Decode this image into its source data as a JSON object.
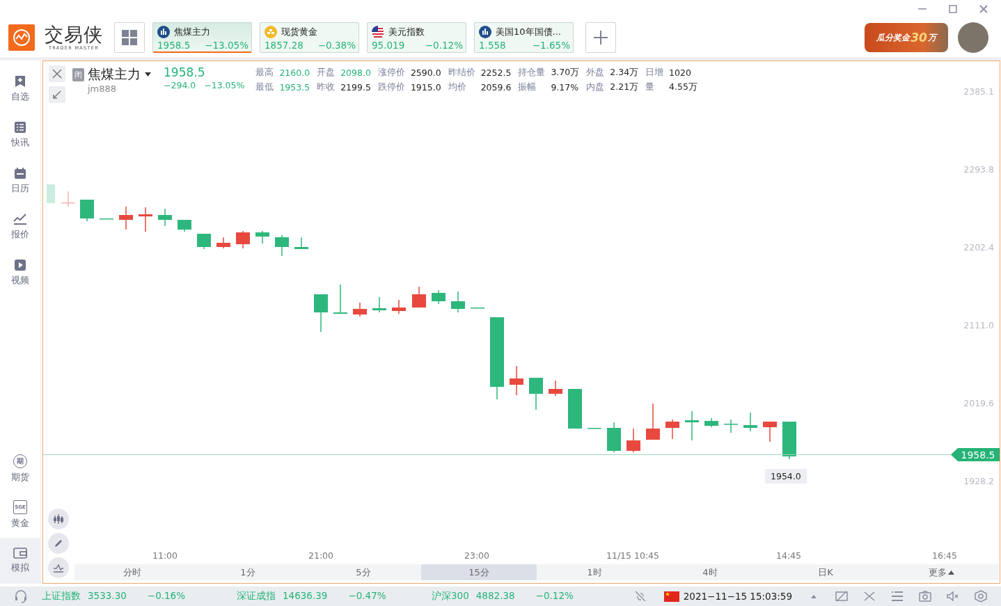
{
  "header": {
    "logo_text": "交易侠",
    "logo_subtitle": "TRADER MASTER",
    "quote_tabs": [
      {
        "kind": "chart",
        "name": "焦煤主力",
        "price": "1958.5",
        "change": "−13.05%",
        "selected": true
      },
      {
        "kind": "gold",
        "name": "现货黄金",
        "price": "1857.28",
        "change": "−0.38%",
        "selected": false
      },
      {
        "kind": "flag",
        "name": "美元指数",
        "price": "95.019",
        "change": "−0.12%",
        "selected": false
      },
      {
        "kind": "chart",
        "name": "美国10年国债...",
        "price": "1.558",
        "change": "−1.65%",
        "selected": false
      }
    ],
    "promo": {
      "text": "瓜分奖金",
      "amount": "30",
      "unit": "万"
    }
  },
  "sidebar": {
    "top": [
      {
        "kind": "bookmark",
        "label": "自选",
        "selected": false
      },
      {
        "kind": "list",
        "label": "快讯",
        "selected": false
      },
      {
        "kind": "calendar",
        "label": "日历",
        "selected": false
      },
      {
        "kind": "trend",
        "label": "报价",
        "selected": false
      },
      {
        "kind": "video",
        "label": "视频",
        "selected": false
      }
    ],
    "bottom": [
      {
        "kind": "futures",
        "badge": "期",
        "label": "期货",
        "selected": false
      },
      {
        "kind": "sge",
        "badge": "SGE",
        "label": "黄金",
        "selected": false
      },
      {
        "kind": "wallet",
        "label": "模拟",
        "selected": true
      }
    ]
  },
  "quote": {
    "status": "闭",
    "name": "焦煤主力",
    "code": "jm888",
    "price": "1958.5",
    "change": "−294.0",
    "change_pct": "−13.05%",
    "stats": [
      [
        {
          "label": "最高",
          "value": "2160.0",
          "color": "#25b377"
        },
        {
          "label": "开盘",
          "value": "2098.0",
          "color": "#25b377"
        },
        {
          "label": "涨停价",
          "value": "2590.0",
          "color": "#222222"
        },
        {
          "label": "昨结价",
          "value": "2252.5",
          "color": "#222222"
        },
        {
          "label": "持仓量",
          "value": "3.70万",
          "color": "#222222"
        },
        {
          "label": "外盘",
          "value": "2.34万",
          "color": "#222222"
        },
        {
          "label": "日增",
          "value": "1020",
          "color": "#222222"
        }
      ],
      [
        {
          "label": "最低",
          "value": "1953.5",
          "color": "#25b377"
        },
        {
          "label": "昨收",
          "value": "2199.5",
          "color": "#222222"
        },
        {
          "label": "跌停价",
          "value": "1915.0",
          "color": "#222222"
        },
        {
          "label": "均价",
          "value": "2059.6",
          "color": "#222222"
        },
        {
          "label": "振幅",
          "value": "9.17%",
          "color": "#222222"
        },
        {
          "label": "内盘",
          "value": "2.21万",
          "color": "#222222"
        },
        {
          "label": "量",
          "value": "4.55万",
          "color": "#222222"
        }
      ]
    ]
  },
  "chart": {
    "y_labels": [
      "2385.1",
      "2293.8",
      "2202.4",
      "2111.0",
      "2019.6",
      "1928.2"
    ],
    "x_labels": [
      "11:00",
      "21:00",
      "23:00",
      "11/15 10:45",
      "14:45",
      "16:45"
    ],
    "last_price": "1958.5",
    "low_marker": "1954.0"
  },
  "periods": [
    {
      "label": "分时",
      "selected": false
    },
    {
      "label": "1分",
      "selected": false
    },
    {
      "label": "5分",
      "selected": false
    },
    {
      "label": "15分",
      "selected": true
    },
    {
      "label": "1时",
      "selected": false
    },
    {
      "label": "4时",
      "selected": false
    },
    {
      "label": "日K",
      "selected": false
    },
    {
      "label": "更多",
      "selected": false
    }
  ],
  "status_bar": {
    "indices": [
      {
        "name": "上证指数",
        "value": "3533.30",
        "change": "−0.16%"
      },
      {
        "name": "深证成指",
        "value": "14636.39",
        "change": "−0.47%"
      },
      {
        "name": "沪深300",
        "value": "4882.38",
        "change": "−0.12%"
      }
    ],
    "datetime": "2021−11−15 15:03:59"
  }
}
